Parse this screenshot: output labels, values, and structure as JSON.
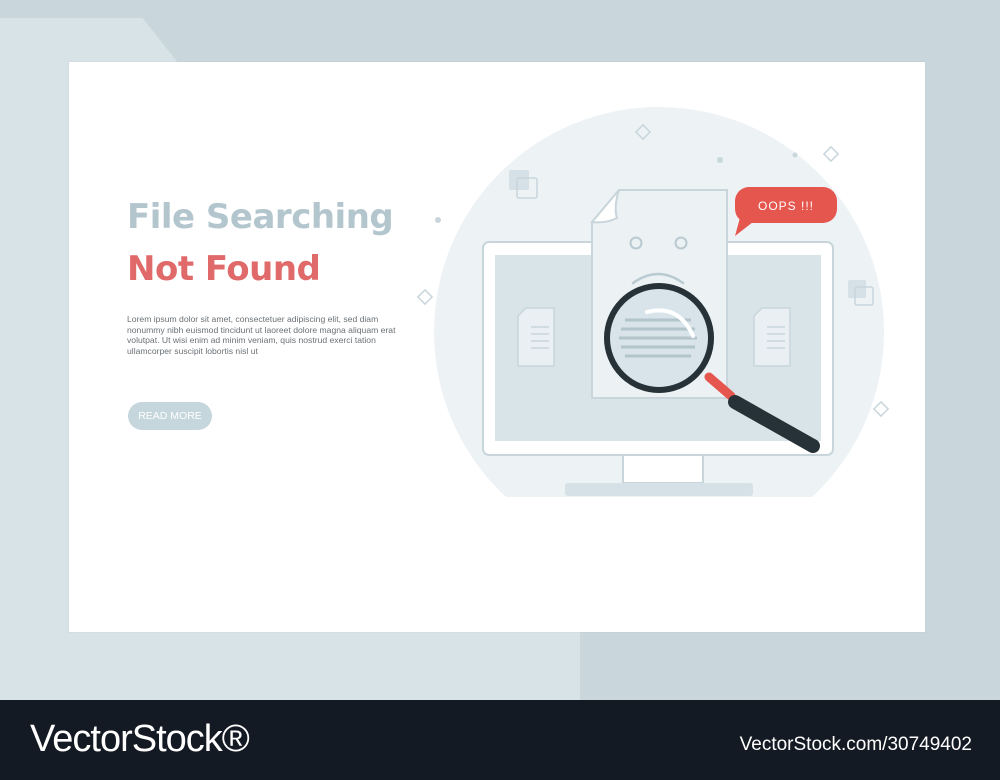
{
  "hero": {
    "title_line1": "File Searching",
    "title_line2": "Not Found",
    "description": "Lorem ipsum dolor sit amet, consectetuer adipiscing elit, sed diam nonummy nibh euismod tincidunt ut laoreet dolore magna aliquam erat volutpat. Ut wisi enim ad minim veniam, quis nostrud exerci tation ullamcorper suscipit lobortis nisl ut",
    "button_label": "READ MORE"
  },
  "illustration": {
    "bubble_text": "OOPS !!!",
    "icons": [
      "monitor-icon",
      "sad-document-icon",
      "magnifier-icon",
      "document-icon",
      "speech-bubble-icon"
    ]
  },
  "footer": {
    "logo": "VectorStock®",
    "image_id": "VectorStock.com/30749402"
  },
  "colors": {
    "title_primary": "#b3c6ce",
    "title_accent": "#e06a6a",
    "button_bg": "#c5d6dc",
    "illustration_fill": "#d9e4e9",
    "line": "#c2d2d9",
    "alert_red": "#e5564f"
  }
}
